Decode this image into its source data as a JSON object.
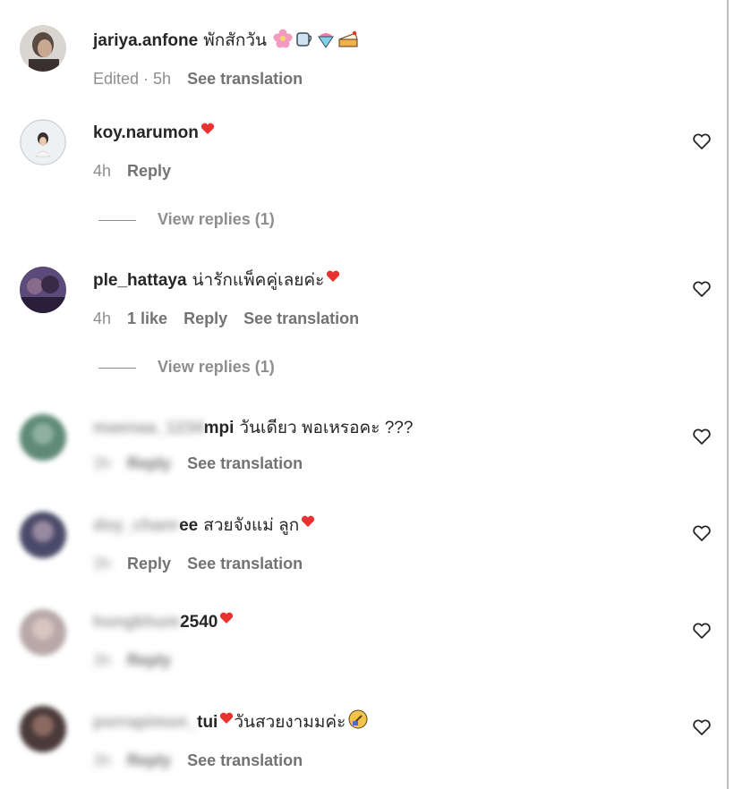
{
  "comments": [
    {
      "username": "jariya.anfone",
      "text": "พักสักวัน",
      "meta": [
        "Edited · 5h"
      ],
      "actions": [
        "See translation"
      ],
      "emojis": [
        "blossom-emoji",
        "tea-emoji",
        "shaved-ice-emoji",
        "cake-emoji"
      ]
    },
    {
      "username": "koy.narumon",
      "text": "",
      "meta": [
        "4h"
      ],
      "actions": [
        "Reply"
      ],
      "replies": "View replies (1)"
    },
    {
      "username": "ple_hattaya",
      "text": "น่ารักแพ็คคู่เลยค่ะ",
      "meta": [
        "4h",
        "1 like"
      ],
      "actions": [
        "Reply",
        "See translation"
      ],
      "replies": "View replies (1)"
    },
    {
      "username_blur": "maenaa_1234",
      "username_visible": "mpi",
      "text": "วันเดียว พอเหรอคะ ???",
      "meta_blur": [
        "3h",
        "Reply"
      ],
      "actions": [
        "See translation"
      ]
    },
    {
      "username_blur": "doy_chanr",
      "username_visible": "ee",
      "text": "สวยจังแม่ ลูก",
      "meta_blur": [
        "3h"
      ],
      "actions": [
        "Reply",
        "See translation"
      ]
    },
    {
      "username_blur": "hongkhum",
      "username_visible": "2540",
      "text": "",
      "meta_blur": [
        "3h",
        "Reply"
      ],
      "actions": []
    },
    {
      "username_blur": "porrapimon_",
      "username_visible": "tui",
      "text": "วันสวยงามมค่ะ",
      "meta_blur": [
        "3h",
        "Reply"
      ],
      "actions": [
        "See translation"
      ]
    }
  ],
  "colors": {
    "heart_red": "#e8322f",
    "meta_gray": "#8e8e8e"
  }
}
